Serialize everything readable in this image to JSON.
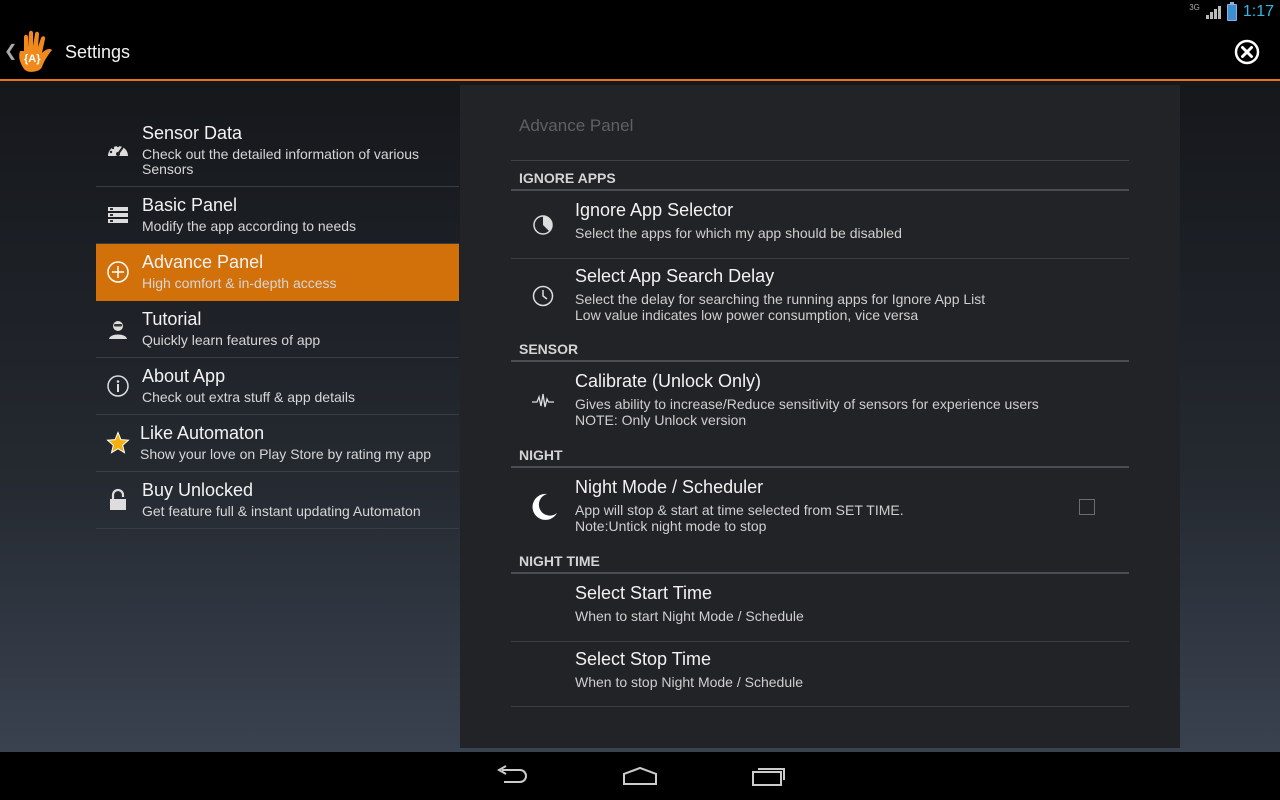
{
  "status_bar": {
    "network": "3G",
    "time": "1:17"
  },
  "action_bar": {
    "title": "Settings",
    "logo_text": "{A}",
    "close_icon": "close-circle-icon"
  },
  "sidebar": {
    "items": [
      {
        "title": "Sensor Data",
        "subtitle": "Check out the detailed information of various Sensors",
        "icon": "dashboard-gauge-icon"
      },
      {
        "title": "Basic Panel",
        "subtitle": "Modify the app according to needs",
        "icon": "server-stack-icon"
      },
      {
        "title": "Advance Panel",
        "subtitle": "High comfort & in-depth access",
        "icon": "plus-circle-icon",
        "active": true
      },
      {
        "title": "Tutorial",
        "subtitle": "Quickly learn features of app",
        "icon": "person-icon"
      },
      {
        "title": "About App",
        "subtitle": "Check out extra stuff & app details",
        "icon": "info-icon"
      },
      {
        "title": "Like Automaton",
        "subtitle": "Show your love on Play Store by rating my app",
        "icon": "star-icon"
      },
      {
        "title": "Buy Unlocked",
        "subtitle": "Get feature full & instant updating Automaton",
        "icon": "lock-icon"
      }
    ]
  },
  "panel": {
    "title": "Advance Panel",
    "sections": {
      "ignore_apps": "IGNORE APPS",
      "sensor": "SENSOR",
      "night": "NIGHT",
      "night_time": "NIGHT TIME"
    },
    "prefs": {
      "ignore_selector": {
        "title": "Ignore App Selector",
        "line1": "Select the apps for which my app should be disabled"
      },
      "search_delay": {
        "title": "Select App Search Delay",
        "line1": "Select the delay for searching the running apps for Ignore App List",
        "line2": "Low value indicates low power consumption, vice versa"
      },
      "calibrate": {
        "title": "Calibrate (Unlock Only)",
        "line1": "Gives ability to increase/Reduce sensitivity of sensors for experience users",
        "line2": "NOTE: Only Unlock version"
      },
      "night_mode": {
        "title": "Night Mode / Scheduler",
        "line1": "App will stop & start at time selected from SET TIME.",
        "line2": "Note:Untick night mode to stop",
        "checked": false
      },
      "start_time": {
        "title": "Select Start Time",
        "line1": "When to start Night Mode / Schedule"
      },
      "stop_time": {
        "title": "Select Stop Time",
        "line1": "When to stop Night Mode / Schedule"
      }
    }
  },
  "colors": {
    "accent": "#e8751a",
    "active_item": "#d2700a",
    "clock": "#33b5e5"
  },
  "nav_bar": {
    "buttons": [
      "back-icon",
      "home-icon",
      "recent-apps-icon"
    ]
  }
}
